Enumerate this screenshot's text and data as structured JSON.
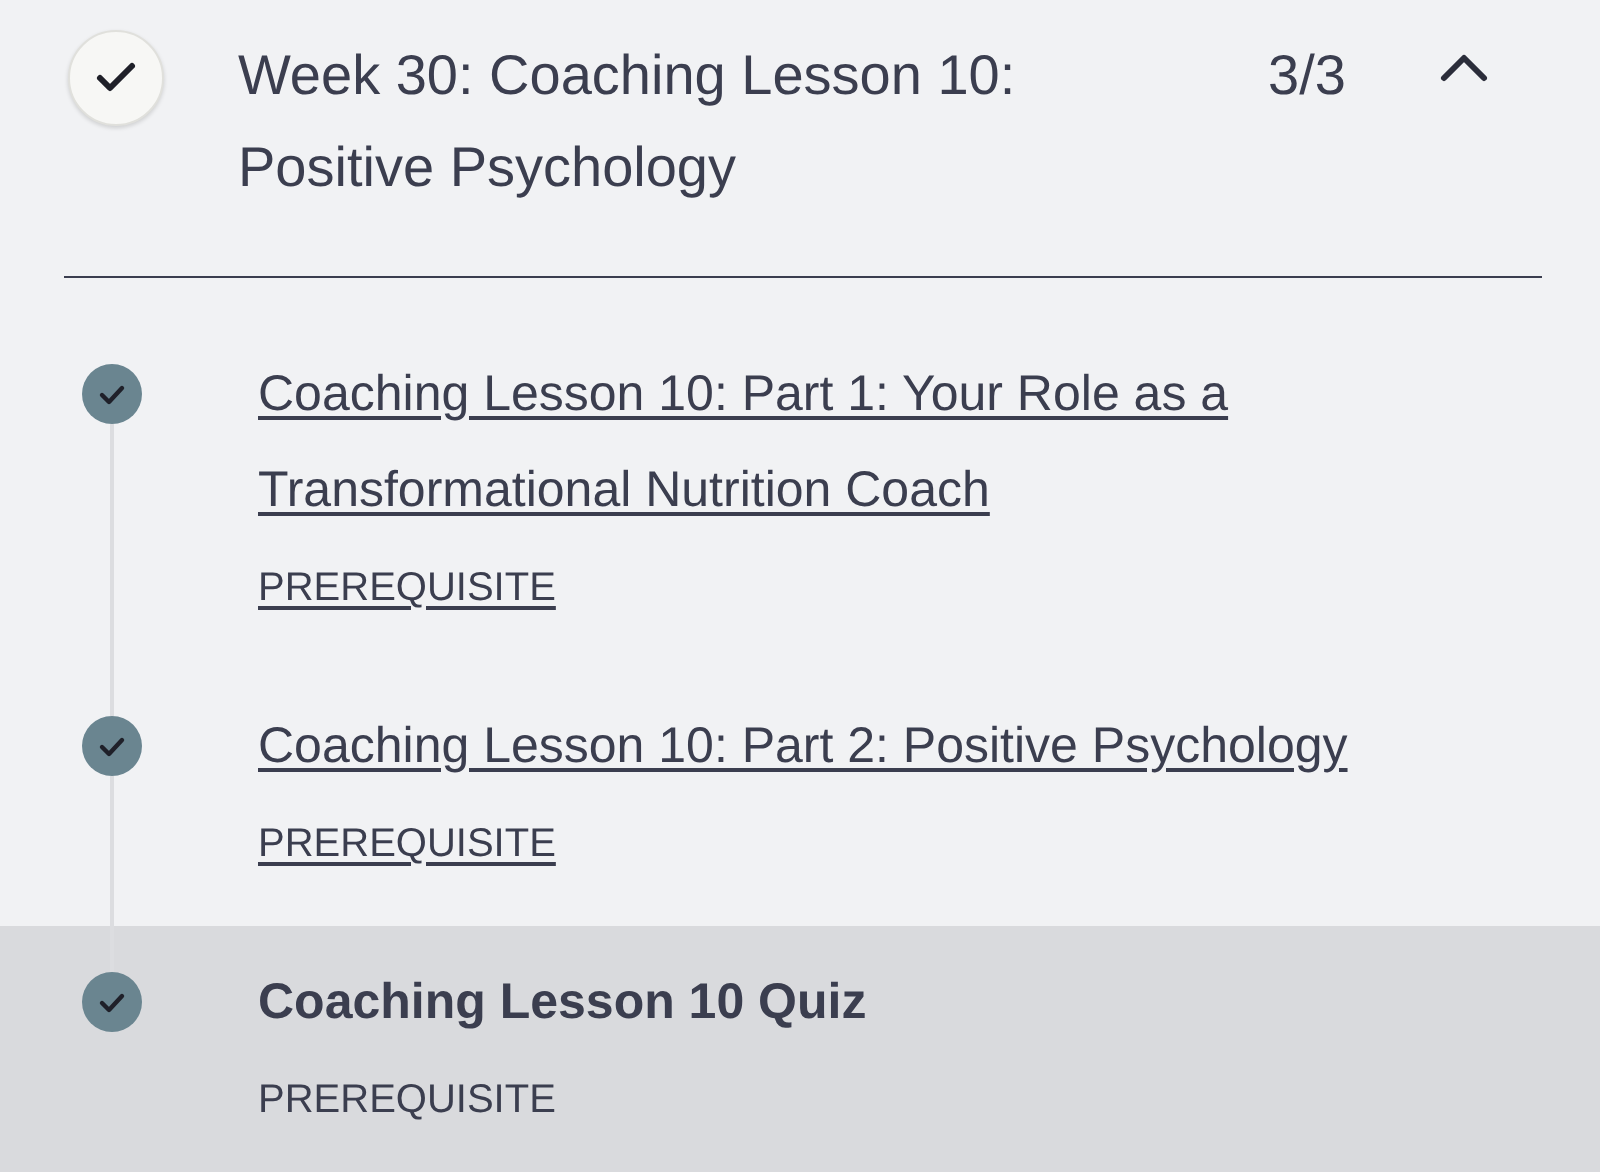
{
  "week": {
    "title": "Week 30: Coaching Lesson 10: Positive Psychology",
    "progress": "3/3",
    "completed": true,
    "expanded": true
  },
  "lessons": [
    {
      "title": "Coaching Lesson 10: Part 1: Your Role as a Transformational Nutrition Coach",
      "tag": "PREREQUISITE",
      "completed": true,
      "selected": false
    },
    {
      "title": "Coaching Lesson 10: Part 2: Positive Psychology",
      "tag": "PREREQUISITE",
      "completed": true,
      "selected": false
    },
    {
      "title": "Coaching Lesson 10 Quiz",
      "tag": "PREREQUISITE",
      "completed": true,
      "selected": true
    }
  ]
}
